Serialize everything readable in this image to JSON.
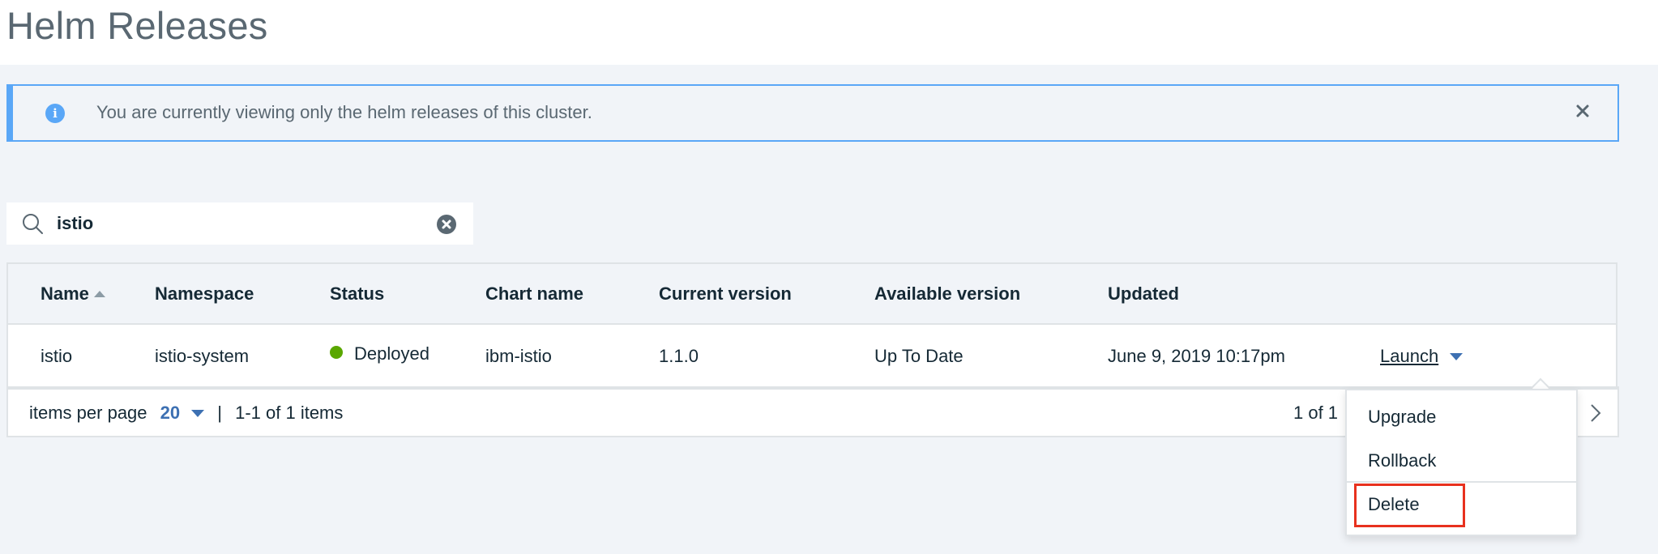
{
  "page": {
    "title": "Helm Releases"
  },
  "notification": {
    "icon": "info-icon",
    "message": "You are currently viewing only the helm releases of this cluster.",
    "close_icon": "close-icon",
    "accent_color": "#5aa7f7"
  },
  "search": {
    "value": "istio",
    "placeholder": "",
    "icon": "search-icon",
    "clear_icon": "clear-circle-icon"
  },
  "table": {
    "columns": [
      {
        "label": "Name",
        "sorted": "ascending"
      },
      {
        "label": "Namespace"
      },
      {
        "label": "Status"
      },
      {
        "label": "Chart name"
      },
      {
        "label": "Current version"
      },
      {
        "label": "Available version"
      },
      {
        "label": "Updated"
      },
      {
        "label": ""
      }
    ],
    "rows": [
      {
        "name": "istio",
        "namespace": "istio-system",
        "status": "Deployed",
        "status_color": "#5aa700",
        "chart_name": "ibm-istio",
        "current_version": "1.1.0",
        "available_version": "Up To Date",
        "updated": "June 9, 2019 10:17pm",
        "action_label": "Launch"
      }
    ]
  },
  "pagination": {
    "items_per_page_label": "items per page",
    "items_per_page_value": "20",
    "separator": "|",
    "range_text": "1-1 of 1 items",
    "page_text": "1 of 1",
    "next_icon": "chevron-right-icon"
  },
  "action_menu": {
    "items": [
      {
        "label": "Upgrade"
      },
      {
        "label": "Rollback"
      },
      {
        "label": "Delete",
        "highlighted": true
      }
    ],
    "highlight_color": "#e8311e"
  }
}
